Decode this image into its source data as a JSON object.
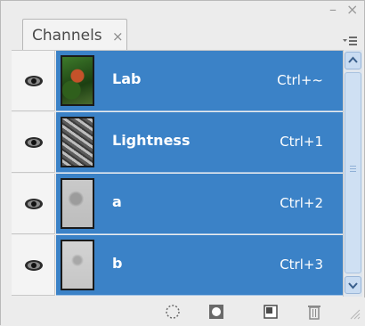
{
  "panel": {
    "tab_label": "Channels",
    "tab_close": "×",
    "minimize": "–",
    "close": "×",
    "flyout_menu_icon": "flyout-menu-icon"
  },
  "channels": [
    {
      "name": "Lab",
      "shortcut": "Ctrl+~",
      "visible": true,
      "thumb": "color"
    },
    {
      "name": "Lightness",
      "shortcut": "Ctrl+1",
      "visible": true,
      "thumb": "gray-dark"
    },
    {
      "name": "a",
      "shortcut": "Ctrl+2",
      "visible": true,
      "thumb": "gray-light"
    },
    {
      "name": "b",
      "shortcut": "Ctrl+3",
      "visible": true,
      "thumb": "gray-light"
    }
  ],
  "bottom_icons": [
    "load-selection-icon",
    "save-selection-icon",
    "new-channel-icon",
    "trash-icon"
  ],
  "colors": {
    "selection": "#3b82c7",
    "panel_bg": "#ececec"
  }
}
